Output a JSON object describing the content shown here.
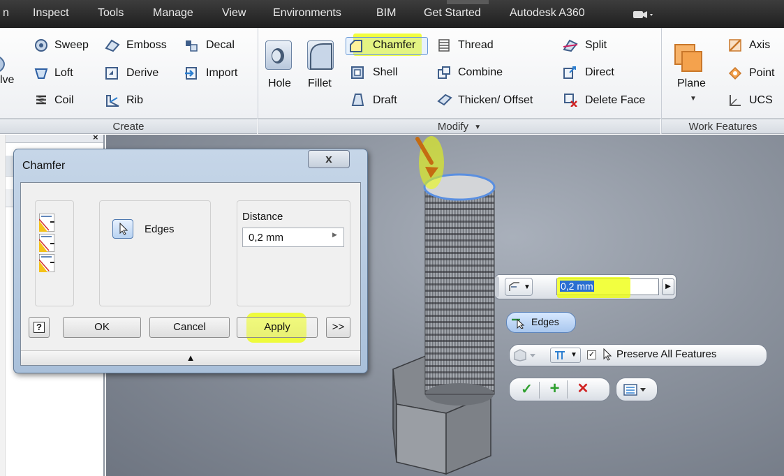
{
  "menubar": {
    "items": [
      "n",
      "Inspect",
      "Tools",
      "Manage",
      "View",
      "Environments",
      "BIM",
      "Get Started",
      "Autodesk A360"
    ]
  },
  "ribbon": {
    "create": {
      "label": "Create",
      "revolve_partial": "lve",
      "items": [
        "Sweep",
        "Emboss",
        "Decal",
        "Loft",
        "Derive",
        "Import",
        "Coil",
        "Rib"
      ]
    },
    "modify": {
      "label": "Modify",
      "hole": "Hole",
      "fillet": "Fillet",
      "chamfer": "Chamfer",
      "thread": "Thread",
      "split": "Split",
      "shell": "Shell",
      "combine": "Combine",
      "direct": "Direct",
      "draft": "Draft",
      "thicken": "Thicken/ Offset",
      "delete_face": "Delete Face"
    },
    "work_features": {
      "label": "Work Features",
      "plane": "Plane",
      "axis": "Axis",
      "point": "Point",
      "ucs": "UCS"
    }
  },
  "dialog": {
    "title": "Chamfer",
    "close_glyph": "x",
    "edges_label": "Edges",
    "distance_label": "Distance",
    "distance_value": "0,2 mm",
    "help_glyph": "?",
    "ok_label": "OK",
    "cancel_label": "Cancel",
    "apply_label": "Apply",
    "more_label": ">>",
    "expand_glyph": "▲"
  },
  "minitoolbar": {
    "distance_value": "0,2 mm",
    "edges_label": "Edges",
    "preserve_label": "Preserve All Features"
  },
  "colors": {
    "highlight": "#eeff00",
    "accept": "#2fa02f",
    "cancel_red": "#d02020",
    "selected_edge": "#5a8fe0"
  }
}
